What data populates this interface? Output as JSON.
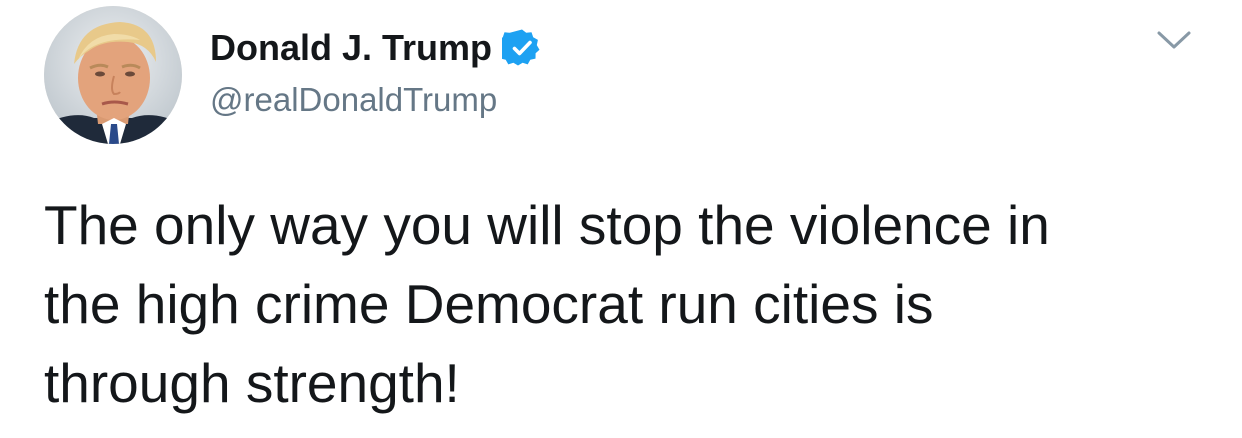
{
  "tweet": {
    "author": {
      "display_name": "Donald J. Trump",
      "handle": "@realDonaldTrump",
      "verified": true,
      "avatar_icon": "profile-photo"
    },
    "text_lines": [
      "The only way you will stop the violence in",
      "the high crime Democrat run cities is",
      "through strength!"
    ],
    "menu_icon": "chevron-down-icon"
  },
  "colors": {
    "text_primary": "#14171a",
    "text_secondary": "#657786",
    "verified_blue": "#1da1f2",
    "caret_gray": "#8899a6",
    "background": "#ffffff"
  }
}
